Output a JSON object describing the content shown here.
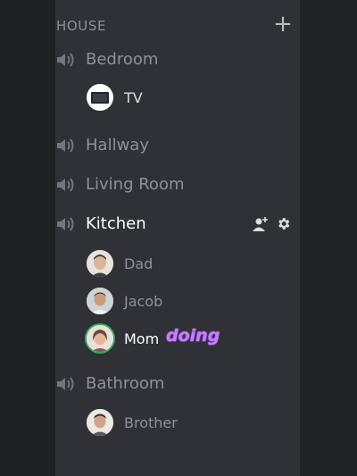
{
  "category": {
    "title": "HOUSE",
    "add_icon": "plus-icon"
  },
  "channels": [
    {
      "name": "Bedroom",
      "icon": "speaker-icon",
      "users": [
        {
          "name": "TV"
        }
      ]
    },
    {
      "name": "Hallway",
      "icon": "speaker-icon",
      "users": []
    },
    {
      "name": "Living Room",
      "icon": "speaker-icon",
      "users": []
    },
    {
      "name": "Kitchen",
      "icon": "speaker-icon",
      "active": true,
      "actions": [
        "add-user-icon",
        "gear-icon"
      ],
      "users": [
        {
          "name": "Dad"
        },
        {
          "name": "Jacob"
        },
        {
          "name": "Mom",
          "status": "doing"
        }
      ]
    },
    {
      "name": "Bathroom",
      "icon": "speaker-icon",
      "users": [
        {
          "name": "Brother"
        }
      ]
    }
  ],
  "colors": {
    "background": "#2f3136",
    "muted_text": "#8e9297",
    "active_text": "#ffffff",
    "speaking_ring": "#3ba55c",
    "highlight": "#c77dff"
  }
}
